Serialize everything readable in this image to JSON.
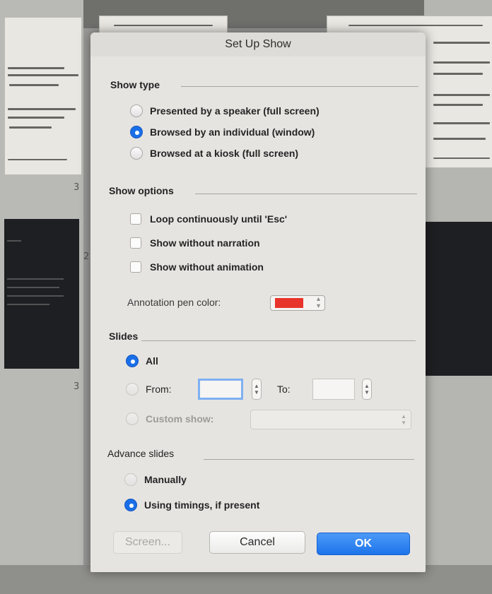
{
  "dialog": {
    "title": "Set Up Show"
  },
  "show_type": {
    "label": "Show type",
    "options": [
      {
        "label": "Presented by a speaker (full screen)",
        "selected": false
      },
      {
        "label": "Browsed by an individual (window)",
        "selected": true
      },
      {
        "label": "Browsed at a kiosk (full screen)",
        "selected": false
      }
    ]
  },
  "show_options": {
    "label": "Show options",
    "loop": {
      "label": "Loop continuously until 'Esc'",
      "checked": false
    },
    "no_narration": {
      "label": "Show without narration",
      "checked": false
    },
    "no_animation": {
      "label": "Show without animation",
      "checked": false
    },
    "pen_color": {
      "label": "Annotation pen color:",
      "value": "#e8332a"
    }
  },
  "slides": {
    "label": "Slides",
    "all": {
      "label": "All",
      "selected": true
    },
    "from": {
      "label": "From:",
      "value": "",
      "selected": false
    },
    "to": {
      "label": "To:",
      "value": ""
    },
    "custom_show": {
      "label": "Custom show:",
      "value": "",
      "enabled": false
    }
  },
  "advance": {
    "label": "Advance slides",
    "manually": {
      "label": "Manually",
      "selected": false
    },
    "timings": {
      "label": "Using timings, if present",
      "selected": true
    }
  },
  "buttons": {
    "screen": "Screen...",
    "cancel": "Cancel",
    "ok": "OK"
  },
  "background": {
    "slide_numbers": [
      "3",
      "2",
      "3"
    ]
  },
  "colors": {
    "accent": "#1a6fe8",
    "dialog_bg": "#e6e4e1"
  }
}
